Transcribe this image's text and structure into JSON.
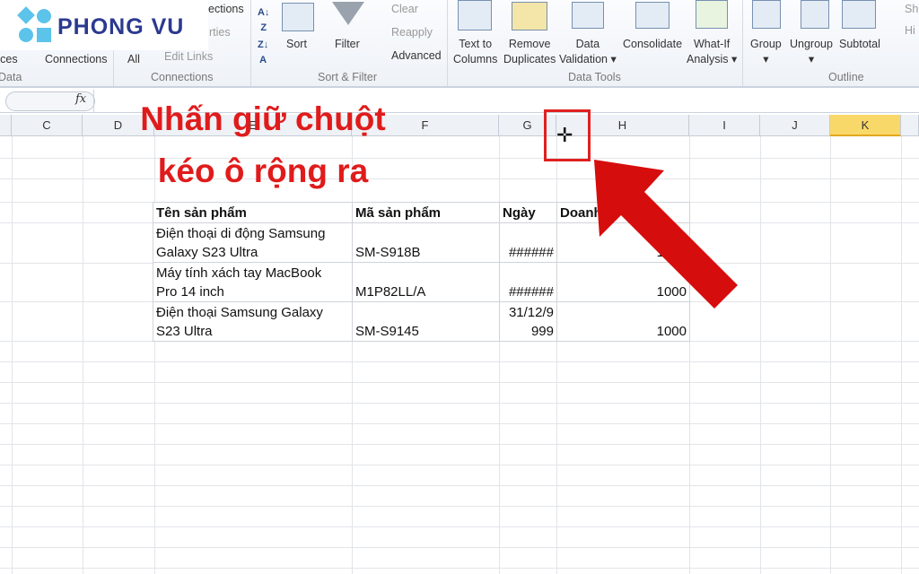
{
  "logo": {
    "text": "PHONG VU"
  },
  "ribbon": {
    "get_data": {
      "sources_label": "rces",
      "group": "Data"
    },
    "connections": {
      "connections_label": "Connections",
      "refresh_all": "All",
      "connections_top": "ections",
      "properties": "rties",
      "edit_links": "Edit Links",
      "group": "Connections"
    },
    "sort_filter": {
      "sort": "Sort",
      "filter": "Filter",
      "clear": "Clear",
      "reapply": "Reapply",
      "advanced": "Advanced",
      "group": "Sort & Filter"
    },
    "data_tools": {
      "text_to_columns": [
        "Text to",
        "Columns"
      ],
      "remove_duplicates": [
        "Remove",
        "Duplicates"
      ],
      "data_validation": [
        "Data",
        "Validation"
      ],
      "consolidate": "Consolidate",
      "what_if": [
        "What-If",
        "Analysis"
      ],
      "group": "Data Tools"
    },
    "outline": {
      "group_btn": "Group",
      "ungroup": "Ungroup",
      "subtotal": "Subtotal",
      "show": "Sh",
      "hide": "Hi",
      "group": "Outline"
    }
  },
  "formula_bar": {
    "fx": "fx",
    "value": ""
  },
  "columns": [
    "C",
    "D",
    "E",
    "F",
    "G",
    "H",
    "I",
    "J",
    "K"
  ],
  "selected_column": "K",
  "table": {
    "headers": [
      "Tên sản phẩm",
      "Mã sản phẩm",
      "Ngày",
      "Doanh số"
    ],
    "rows": [
      {
        "name": [
          "Điện thoại di động Samsung",
          "Galaxy S23 Ultra"
        ],
        "code": "SM-S918B",
        "date": [
          "",
          "######"
        ],
        "sales": "1000"
      },
      {
        "name": [
          "Máy tính xách tay MacBook",
          "Pro 14 inch"
        ],
        "code": "M1P82LL/A",
        "date": [
          "",
          "######"
        ],
        "sales": "1000"
      },
      {
        "name": [
          "Điện thoại Samsung Galaxy",
          "S23 Ultra"
        ],
        "code": "SM-S9145",
        "date": [
          "31/12/9",
          "999"
        ],
        "sales": "1000"
      }
    ]
  },
  "annotation": {
    "line1": "Nhấn giữ chuột",
    "line2": "kéo ô rộng ra",
    "color": "#e01b1b"
  }
}
